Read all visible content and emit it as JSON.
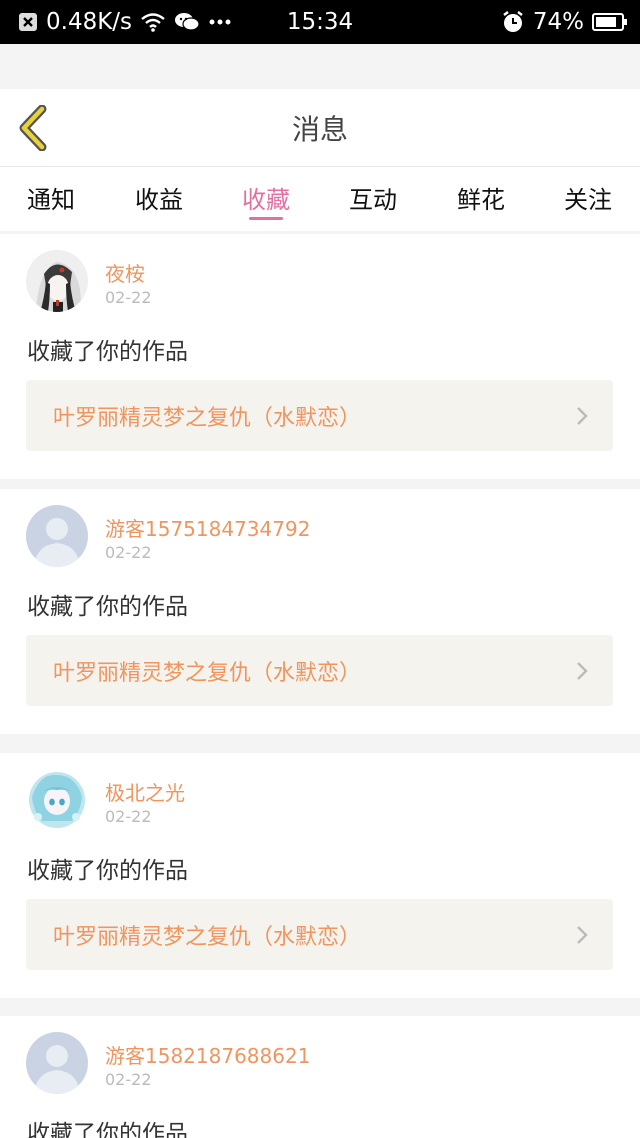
{
  "status_bar": {
    "speed": "0.48K/s",
    "time": "15:34",
    "battery": "74%"
  },
  "header": {
    "title": "消息"
  },
  "tabs": [
    {
      "label": "通知",
      "active": false
    },
    {
      "label": "收益",
      "active": false
    },
    {
      "label": "收藏",
      "active": true
    },
    {
      "label": "互动",
      "active": false
    },
    {
      "label": "鲜花",
      "active": false
    },
    {
      "label": "关注",
      "active": false
    }
  ],
  "notifications": [
    {
      "user": "夜桉",
      "date": "02-22",
      "action": "收藏了你的作品",
      "work": "叶罗丽精灵梦之复仇（水默恋）",
      "avatar": "anime-girl-dark"
    },
    {
      "user": "游客1575184734792",
      "date": "02-22",
      "action": "收藏了你的作品",
      "work": "叶罗丽精灵梦之复仇（水默恋）",
      "avatar": "default-user"
    },
    {
      "user": "极北之光",
      "date": "02-22",
      "action": "收藏了你的作品",
      "work": "叶罗丽精灵梦之复仇（水默恋）",
      "avatar": "anime-girl-blue"
    },
    {
      "user": "游客1582187688621",
      "date": "02-22",
      "action": "收藏了你的作品",
      "work": "",
      "avatar": "default-user"
    }
  ],
  "colors": {
    "accent": "#e271a2",
    "name": "#f0955e",
    "back_icon": "#e8d23a"
  }
}
